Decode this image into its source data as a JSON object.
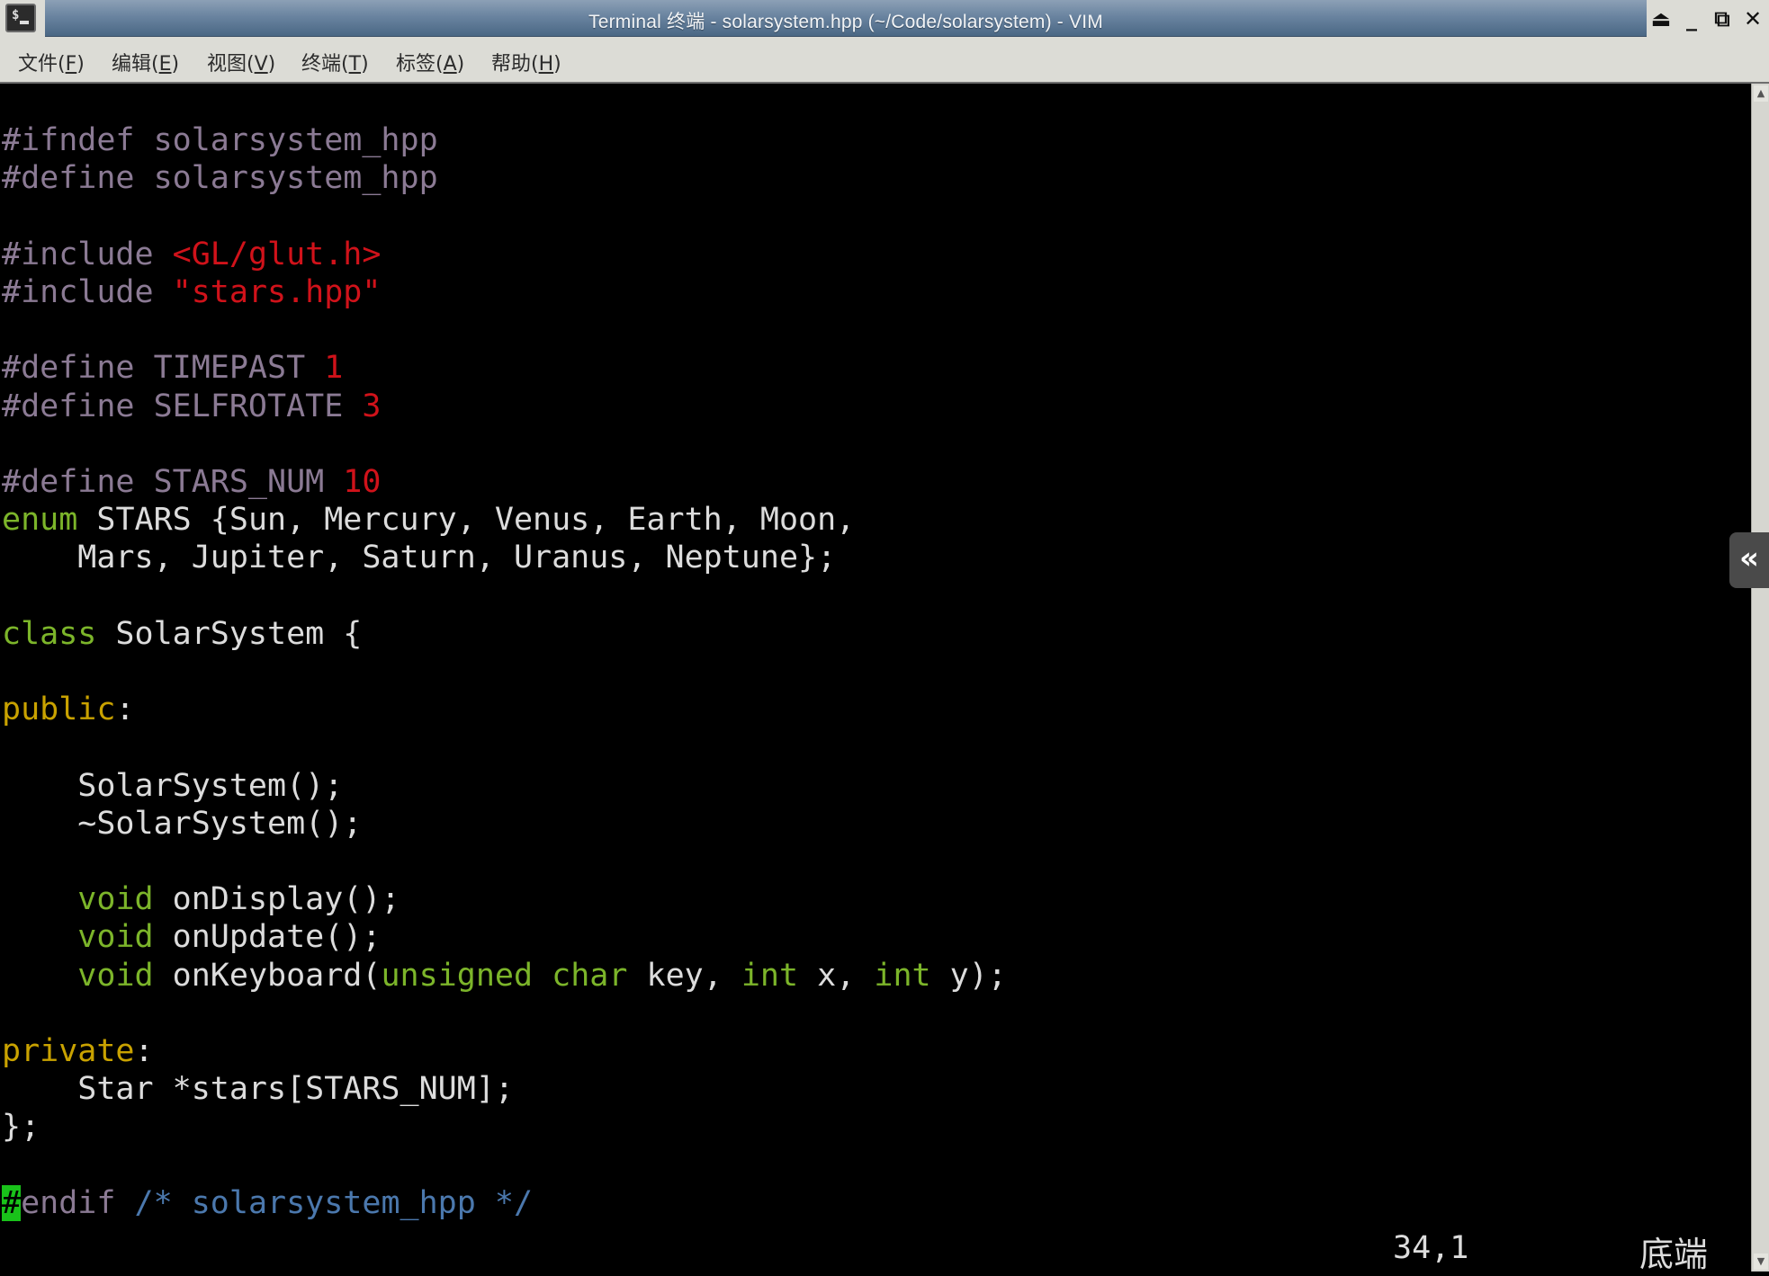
{
  "window": {
    "title": "Terminal 终端 - solarsystem.hpp (~/Code/solarsystem) - VIM",
    "app_icon": "terminal-icon",
    "buttons": [
      {
        "name": "shade",
        "glyph": "⏏"
      },
      {
        "name": "minimize",
        "glyph": "_"
      },
      {
        "name": "maximize",
        "glyph": "⧉"
      },
      {
        "name": "close",
        "glyph": "✕"
      }
    ]
  },
  "menu": [
    {
      "label": "文件",
      "mnemonic": "F"
    },
    {
      "label": "编辑",
      "mnemonic": "E"
    },
    {
      "label": "视图",
      "mnemonic": "V"
    },
    {
      "label": "终端",
      "mnemonic": "T"
    },
    {
      "label": "标签",
      "mnemonic": "A"
    },
    {
      "label": "帮助",
      "mnemonic": "H"
    }
  ],
  "editor": {
    "lines": [
      {
        "row": 1,
        "segments": [
          [
            "pp",
            "#ifndef solarsystem_hpp"
          ]
        ]
      },
      {
        "row": 2,
        "segments": [
          [
            "pp",
            "#define solarsystem_hpp"
          ]
        ]
      },
      {
        "row": 4,
        "segments": [
          [
            "pp",
            "#include "
          ],
          [
            "str",
            "<GL/glut.h>"
          ]
        ]
      },
      {
        "row": 5,
        "segments": [
          [
            "pp",
            "#include "
          ],
          [
            "str",
            "\"stars.hpp\""
          ]
        ]
      },
      {
        "row": 7,
        "segments": [
          [
            "pp",
            "#define TIMEPAST "
          ],
          [
            "str",
            "1"
          ]
        ]
      },
      {
        "row": 8,
        "segments": [
          [
            "pp",
            "#define SELFROTATE "
          ],
          [
            "str",
            "3"
          ]
        ]
      },
      {
        "row": 10,
        "segments": [
          [
            "pp",
            "#define STARS_NUM "
          ],
          [
            "str",
            "10"
          ]
        ]
      },
      {
        "row": 11,
        "segments": [
          [
            "kw",
            "enum"
          ],
          [
            "txt",
            " STARS {Sun, Mercury, Venus, Earth, Moon,"
          ]
        ]
      },
      {
        "row": 12,
        "segments": [
          [
            "txt",
            "    Mars, Jupiter, Saturn, Uranus, Neptune};"
          ]
        ]
      },
      {
        "row": 14,
        "segments": [
          [
            "kw",
            "class"
          ],
          [
            "txt",
            " SolarSystem {"
          ]
        ]
      },
      {
        "row": 16,
        "segments": [
          [
            "lbl",
            "public"
          ],
          [
            "txt",
            ":"
          ]
        ]
      },
      {
        "row": 18,
        "segments": [
          [
            "txt",
            "    SolarSystem();"
          ]
        ]
      },
      {
        "row": 19,
        "segments": [
          [
            "txt",
            "    ~SolarSystem();"
          ]
        ]
      },
      {
        "row": 21,
        "segments": [
          [
            "txt",
            "    "
          ],
          [
            "kw",
            "void"
          ],
          [
            "txt",
            " onDisplay();"
          ]
        ]
      },
      {
        "row": 22,
        "segments": [
          [
            "txt",
            "    "
          ],
          [
            "kw",
            "void"
          ],
          [
            "txt",
            " onUpdate();"
          ]
        ]
      },
      {
        "row": 23,
        "segments": [
          [
            "txt",
            "    "
          ],
          [
            "kw",
            "void"
          ],
          [
            "txt",
            " onKeyboard("
          ],
          [
            "kw",
            "unsigned"
          ],
          [
            "txt",
            " "
          ],
          [
            "kw",
            "char"
          ],
          [
            "txt",
            " key, "
          ],
          [
            "kw",
            "int"
          ],
          [
            "txt",
            " x, "
          ],
          [
            "kw",
            "int"
          ],
          [
            "txt",
            " y);"
          ]
        ]
      },
      {
        "row": 25,
        "segments": [
          [
            "lbl",
            "private"
          ],
          [
            "txt",
            ":"
          ]
        ]
      },
      {
        "row": 26,
        "segments": [
          [
            "txt",
            "    Star *stars[STARS_NUM];"
          ]
        ]
      },
      {
        "row": 27,
        "segments": [
          [
            "txt",
            "};"
          ]
        ]
      },
      {
        "row": 29,
        "segments": [
          [
            "cur",
            "#"
          ],
          [
            "pp",
            "endif "
          ],
          [
            "cmt",
            "/* solarsystem_hpp */"
          ]
        ]
      }
    ],
    "status": {
      "cursor_position": "34,1",
      "scroll_position": "底端"
    },
    "colors": {
      "preprocessor": "#8b7a94",
      "constant": "#d0121a",
      "keyword": "#7cb52a",
      "label": "#c9a200",
      "comment": "#4b78ad",
      "cursor": "#19c21a",
      "text": "#dcdcdc",
      "background": "#000000"
    }
  },
  "side_tab": {
    "glyph": "«",
    "icon": "double-chevron-left-icon"
  },
  "scrollbar": {
    "up": "▲",
    "down": "▼"
  }
}
